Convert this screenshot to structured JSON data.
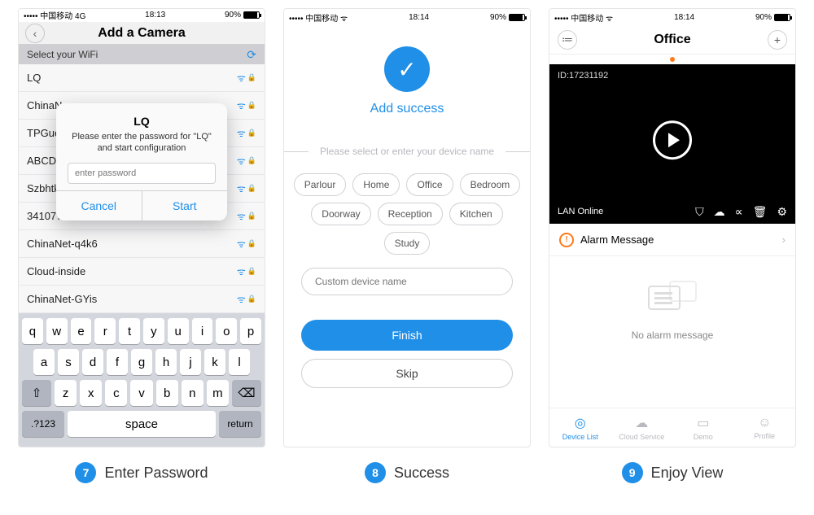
{
  "status": {
    "carrier_4g": "••••• 中国移动 4G",
    "carrier_wifi": "••••• 中国移动 ᯤ",
    "time1": "18:13",
    "time2": "18:14",
    "battery": "90%"
  },
  "phone1": {
    "title": "Add a Camera",
    "select_label": "Select your WiFi",
    "networks": [
      "LQ",
      "ChinaN",
      "TPGue",
      "ABCD",
      "Szbhtk",
      "341077e1",
      "ChinaNet-q4k6",
      "Cloud-inside",
      "ChinaNet-GYis"
    ],
    "dialog": {
      "title": "LQ",
      "msg": "Please enter the password for \"LQ\" and start configuration",
      "placeholder": "enter password",
      "cancel": "Cancel",
      "start": "Start"
    },
    "keyboard": {
      "r1": [
        "q",
        "w",
        "e",
        "r",
        "t",
        "y",
        "u",
        "i",
        "o",
        "p"
      ],
      "r2": [
        "a",
        "s",
        "d",
        "f",
        "g",
        "h",
        "j",
        "k",
        "l"
      ],
      "r3": [
        "z",
        "x",
        "c",
        "v",
        "b",
        "n",
        "m"
      ],
      "n123": ".?123",
      "space": "space",
      "return": "return"
    }
  },
  "phone2": {
    "title": "Add success",
    "select_hint": "Please select or enter your device name",
    "chips": [
      "Parlour",
      "Home",
      "Office",
      "Bedroom",
      "Doorway",
      "Reception",
      "Kitchen",
      "Study"
    ],
    "custom_ph": "Custom device name",
    "finish": "Finish",
    "skip": "Skip"
  },
  "phone3": {
    "title": "Office",
    "device_id": "ID:17231192",
    "lan": "LAN Online",
    "alarm_label": "Alarm Message",
    "empty": "No alarm message",
    "tabs": [
      "Device List",
      "Cloud Service",
      "Demo",
      "Profile"
    ]
  },
  "captions": {
    "c7": "Enter Password",
    "c8": "Success",
    "c9": "Enjoy View",
    "n7": "7",
    "n8": "8",
    "n9": "9"
  }
}
